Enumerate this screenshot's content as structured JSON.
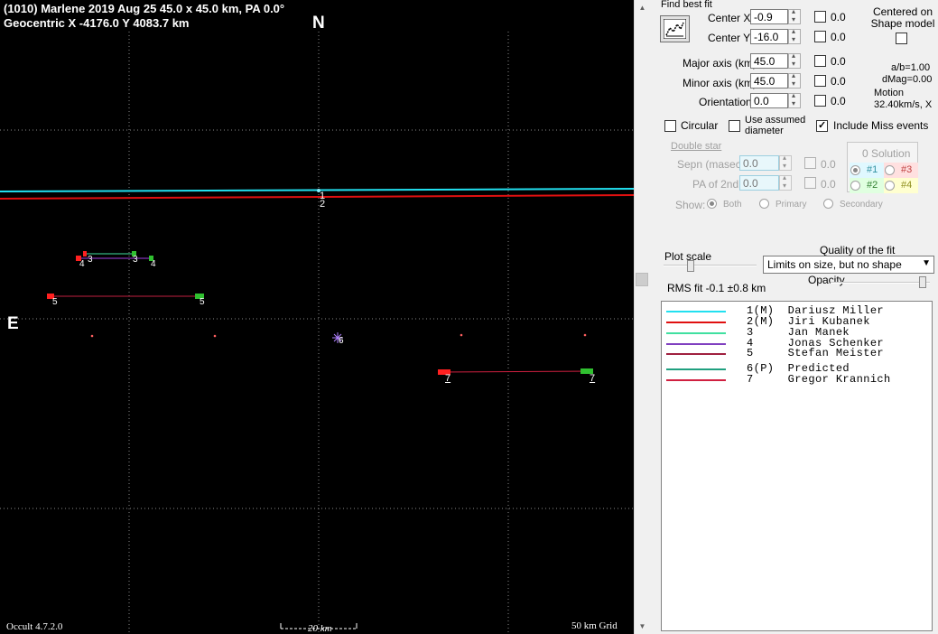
{
  "plot": {
    "header_line1": "(1010) Marlene  2019 Aug 25  45.0 x 45.0 km,  PA 0.0°",
    "header_line2": "Geocentric  X  -4176.0  Y 4083.7 km",
    "north": "N",
    "east": "E",
    "version": "Occult 4.7.2.0",
    "scale_bar": "20 km",
    "grid_label": "50 km Grid",
    "chord_labels": [
      "1",
      "2",
      "3",
      "3",
      "4",
      "4",
      "5",
      "5",
      "6",
      "7",
      "7"
    ]
  },
  "panel": {
    "find_best_fit": "Find best fit",
    "center_x_label": "Center X",
    "center_x_value": "-0.9",
    "center_x_step": "0.0",
    "center_y_label": "Center Y",
    "center_y_value": "-16.0",
    "center_y_step": "0.0",
    "centered_on_shape": "Centered on Shape model",
    "major_label": "Major axis (km)",
    "major_value": "45.0",
    "major_step": "0.0",
    "minor_label": "Minor axis (km)",
    "minor_value": "45.0",
    "minor_step": "0.0",
    "orient_label": "Orientation",
    "orient_value": "0.0",
    "orient_step": "0.0",
    "ab_ratio": "a/b=1.00",
    "dmag": "dMag=0.00",
    "motion_label": "Motion",
    "motion_value": "32.40km/s, X",
    "circular": "Circular",
    "use_assumed": "Use assumed diameter",
    "include_miss": "Include Miss events",
    "double_star": "Double star",
    "sepn_label": "Sepn (masec)",
    "sepn_value": "0.0",
    "sepn_step": "0.0",
    "pa2_label": "PA of 2nd",
    "pa2_value": "0.0",
    "pa2_step": "0.0",
    "show_label": "Show:",
    "show_both": "Both",
    "show_primary": "Primary",
    "show_secondary": "Secondary",
    "solution_title": "0 Solution",
    "sol1": "#1",
    "sol2": "#2",
    "sol3": "#3",
    "sol4": "#4",
    "plot_scale": "Plot scale",
    "quality_label": "Quality of the fit",
    "quality_value": "Limits on size, but no shape",
    "opacity_label": "Opacity",
    "rms_fit": "RMS fit -0.1 ±0.8 km"
  },
  "legend": [
    {
      "text": "1(M)  Dariusz Miller",
      "color": "#22e0f0"
    },
    {
      "text": "2(M)  Jiri Kubanek",
      "color": "#e01010"
    },
    {
      "text": "3     Jan Manek",
      "color": "#40e0a0"
    },
    {
      "text": "4     Jonas Schenker",
      "color": "#8040c0"
    },
    {
      "text": "5     Stefan Meister",
      "color": "#a02040"
    },
    {
      "text": "6(P)  Predicted",
      "color": "#20a080"
    },
    {
      "text": "7     Gregor Krannich",
      "color": "#d02040"
    }
  ],
  "colors": {
    "chord_cyan": "#22e0f0",
    "chord_red": "#e01010",
    "chord_purple": "#a040e0",
    "chord_dark_red": "#c02040",
    "disappear_marker": "#ff2020",
    "reappear_marker": "#30c030",
    "predicted_marker": "#b080ff",
    "background": "#000000"
  }
}
